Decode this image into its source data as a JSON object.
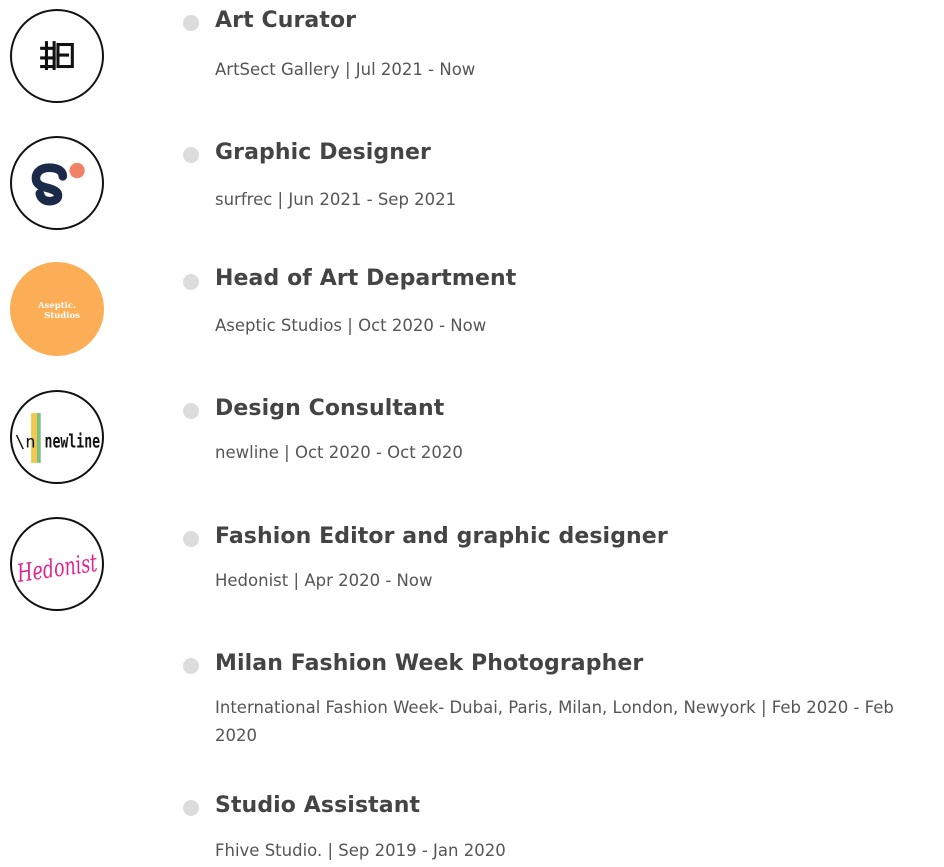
{
  "experience": [
    {
      "title": "Art Curator",
      "company": "ArtSect Gallery",
      "period": "Jul 2021 - Now",
      "logo": "artsect-gallery-logo"
    },
    {
      "title": "Graphic Designer",
      "company": "surfrec",
      "period": "Jun 2021 - Sep 2021",
      "logo": "surfrec-logo"
    },
    {
      "title": "Head of Art Department",
      "company": "Aseptic Studios",
      "period": "Oct 2020 - Now",
      "logo": "aseptic-studios-logo",
      "logo_text": [
        "Aseptic.",
        "Studios"
      ]
    },
    {
      "title": "Design Consultant",
      "company": "newline",
      "period": "Oct 2020 - Oct 2020",
      "logo": "newline-logo",
      "logo_text": "newline"
    },
    {
      "title": "Fashion Editor and graphic designer",
      "company": "Hedonist",
      "period": "Apr 2020 - Now",
      "logo": "hedonist-logo",
      "logo_text": "Hedonist"
    },
    {
      "title": "Milan Fashion Week Photographer",
      "company": "International Fashion Week- Dubai, Paris, Milan, London, Newyork",
      "period": "Feb 2020 - Feb 2020"
    },
    {
      "title": "Studio Assistant",
      "company": "Fhive Studio.",
      "period": "Sep 2019 - Jan 2020"
    }
  ],
  "separator": " | ",
  "colors": {
    "title": "#444444",
    "meta": "#555555",
    "bullet": "#dcdcdc",
    "logo_border": "#111111",
    "surfrec_navy": "#1c2a4a",
    "surfrec_coral": "#f0826a",
    "aseptic_orange": "#fbae56",
    "hedonist_pink": "#e0208c"
  }
}
